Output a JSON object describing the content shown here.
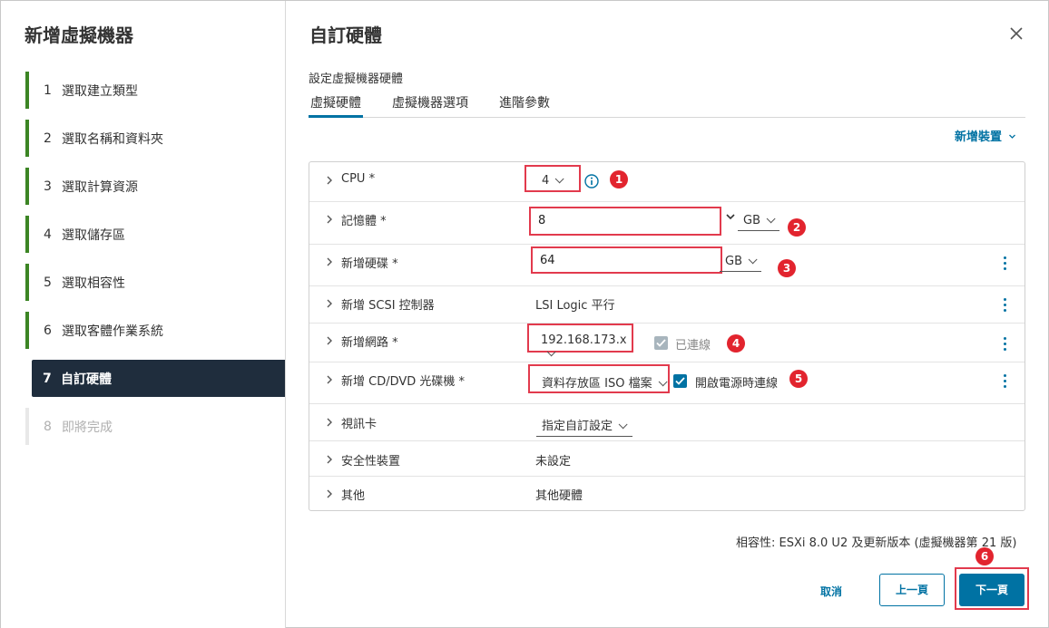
{
  "wizard": {
    "title": "新增虛擬機器",
    "steps": [
      {
        "num": "1",
        "label": "選取建立類型"
      },
      {
        "num": "2",
        "label": "選取名稱和資料夾"
      },
      {
        "num": "3",
        "label": "選取計算資源"
      },
      {
        "num": "4",
        "label": "選取儲存區"
      },
      {
        "num": "5",
        "label": "選取相容性"
      },
      {
        "num": "6",
        "label": "選取客體作業系統"
      },
      {
        "num": "7",
        "label": "自訂硬體"
      },
      {
        "num": "8",
        "label": "即將完成"
      }
    ]
  },
  "page": {
    "title": "自訂硬體",
    "subtitle": "設定虛擬機器硬體",
    "tabs": [
      "虛擬硬體",
      "虛擬機器選項",
      "進階參數"
    ],
    "add_device": "新增裝置"
  },
  "hardware": {
    "cpu": {
      "label": "CPU *",
      "value": "4",
      "badge": "1"
    },
    "memory": {
      "label": "記憶體 *",
      "value": "8",
      "unit": "GB",
      "badge": "2"
    },
    "disk": {
      "label": "新增硬碟 *",
      "value": "64",
      "unit": "GB",
      "badge": "3"
    },
    "scsi": {
      "label": "新增 SCSI 控制器",
      "value": "LSI Logic 平行"
    },
    "network": {
      "label": "新增網路 *",
      "value": "192.168.173.x",
      "connected_label": "已連線",
      "badge": "4"
    },
    "cdrom": {
      "label": "新增 CD/DVD 光碟機 *",
      "value": "資料存放區 ISO 檔案",
      "power_on_label": "開啟電源時連線",
      "badge": "5"
    },
    "video": {
      "label": "視訊卡",
      "value": "指定自訂設定"
    },
    "security": {
      "label": "安全性裝置",
      "value": "未設定"
    },
    "other": {
      "label": "其他",
      "value": "其他硬體"
    }
  },
  "compat": "相容性: ESXi 8.0 U2 及更新版本 (虛擬機器第 21 版)",
  "footer": {
    "cancel": "取消",
    "back": "上一頁",
    "next": "下一頁",
    "next_badge": "6"
  },
  "colors": {
    "accent": "#0072a3",
    "highlight": "#e23a4d",
    "badge": "#e2242e",
    "done_step": "#3c8524",
    "active_step": "#1f2d3d"
  }
}
